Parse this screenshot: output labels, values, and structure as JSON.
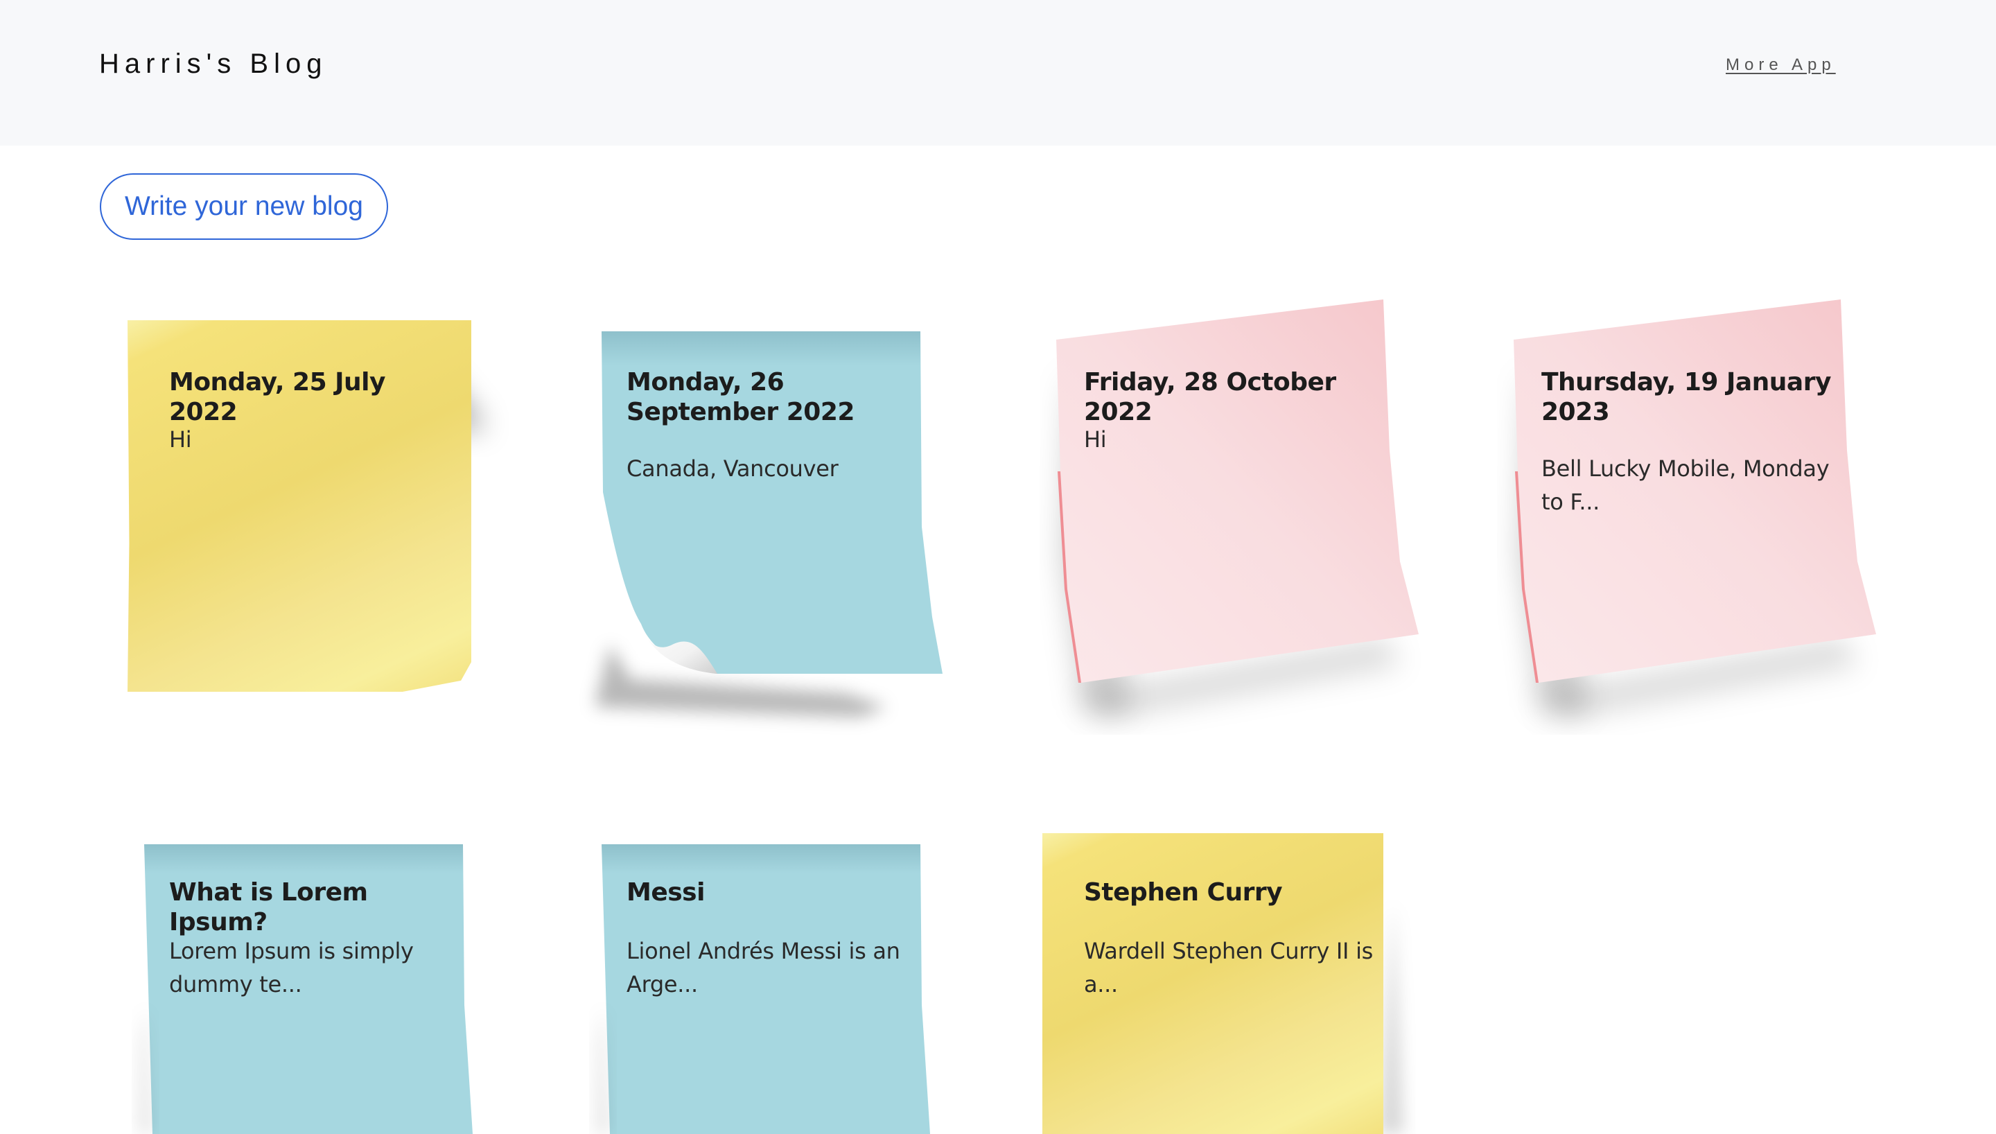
{
  "header": {
    "brand": "Harris's Blog",
    "more_app": "More App"
  },
  "actions": {
    "write_label": "Write your new blog"
  },
  "notes": [
    {
      "title": "Monday, 25 July 2022",
      "excerpt": "Hi",
      "color": "#f5e27a"
    },
    {
      "title": "Monday, 26 September 2022",
      "excerpt": "Canada, Vancouver",
      "color": "#a6d7e0"
    },
    {
      "title": "Friday, 28 October 2022",
      "excerpt": "Hi",
      "color": "#f9dfe2"
    },
    {
      "title": "Thursday, 19 January 2023",
      "excerpt": "Bell Lucky Mobile, Monday to F...",
      "color": "#f9dfe2"
    },
    {
      "title": "What is Lorem Ipsum?",
      "excerpt": "Lorem Ipsum is simply dummy te...",
      "color": "#a6d7e0"
    },
    {
      "title": "Messi",
      "excerpt": "Lionel Andrés Messi is an Arge...",
      "color": "#a6d7e0"
    },
    {
      "title": "Stephen Curry",
      "excerpt": "Wardell Stephen Curry II is a...",
      "color": "#f5e27a"
    }
  ]
}
